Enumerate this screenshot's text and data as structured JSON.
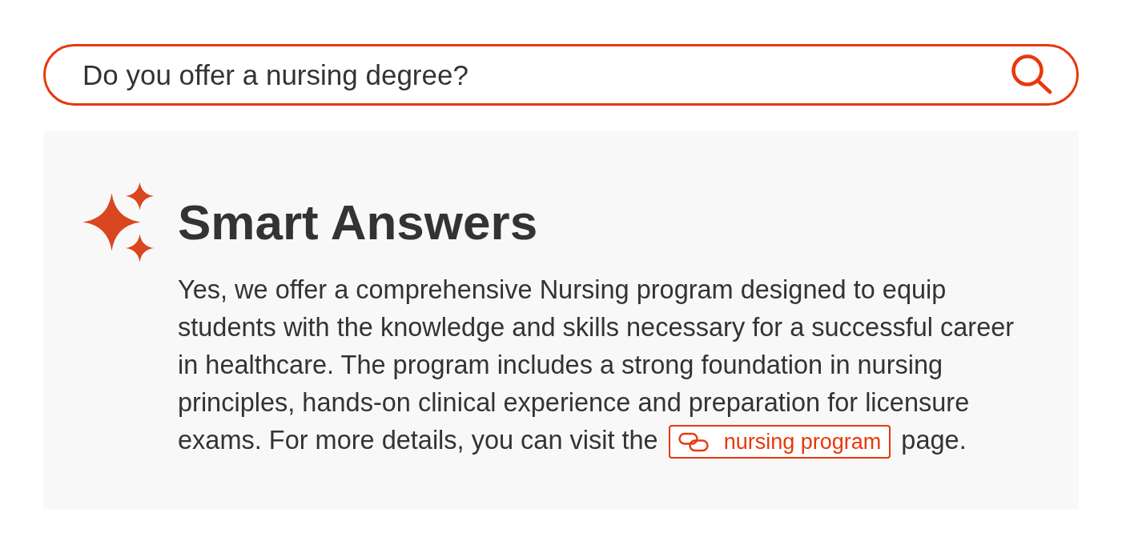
{
  "search": {
    "value": "Do you offer a nursing degree?"
  },
  "answer_panel": {
    "title": "Smart Answers",
    "text_before": "Yes, we offer a comprehensive Nursing program designed to equip students with the knowledge and skills necessary for a successful career in healthcare. The program includes a strong foundation in nursing principles, hands-on clinical experience and preparation for licensure exams. For more details, you can visit the",
    "link": {
      "label": "nursing program"
    },
    "text_after": "page."
  }
}
